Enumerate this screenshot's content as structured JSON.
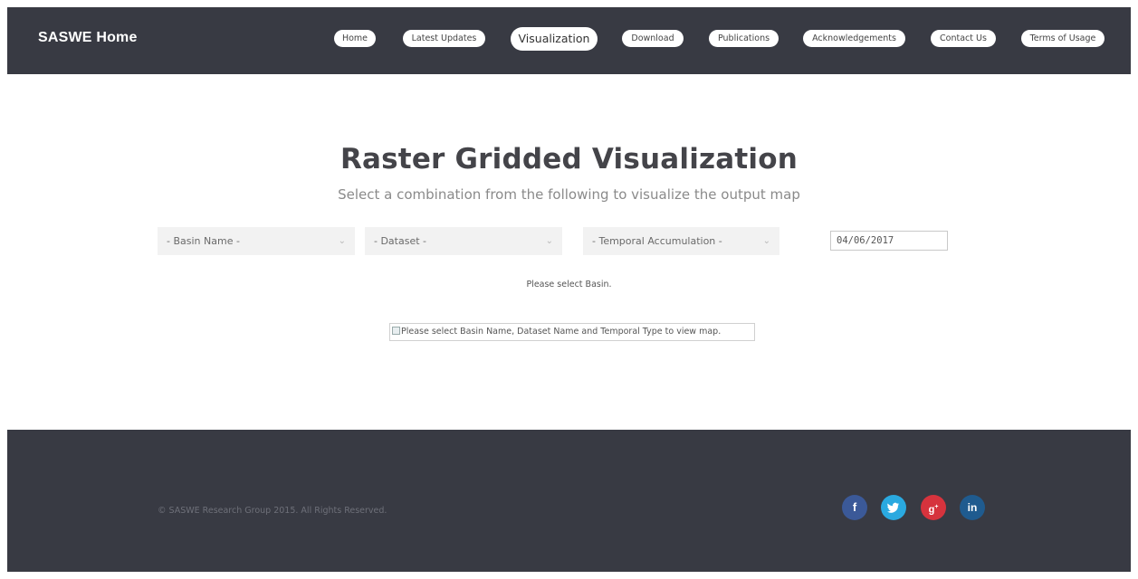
{
  "header": {
    "brand": "SASWE Home",
    "nav": [
      {
        "label": "Home"
      },
      {
        "label": "Latest Updates"
      },
      {
        "label": "Visualization",
        "active": true
      },
      {
        "label": "Download"
      },
      {
        "label": "Publications"
      },
      {
        "label": "Acknowledgements"
      },
      {
        "label": "Contact Us"
      },
      {
        "label": "Terms of Usage"
      }
    ]
  },
  "main": {
    "title": "Raster Gridded Visualization",
    "subtitle": "Select a combination from the following to visualize the output map",
    "selects": {
      "basin": "- Basin Name -",
      "dataset": "- Dataset -",
      "temporal": "- Temporal Accumulation -"
    },
    "date_value": "04/06/2017",
    "status": "Please select Basin.",
    "map_alt": "Please select Basin Name, Dataset Name and Temporal Type to view map."
  },
  "footer": {
    "copyright": "© SASWE Research Group 2015. All Rights Reserved.",
    "social": [
      {
        "icon": "facebook-icon",
        "glyph": "f",
        "color": "#3b5998"
      },
      {
        "icon": "twitter-icon",
        "glyph": "t",
        "color": "#2aa9e0"
      },
      {
        "icon": "google-plus-icon",
        "glyph": "g+",
        "color": "#d6333d"
      },
      {
        "icon": "linkedin-icon",
        "glyph": "in",
        "color": "#1f5b8f"
      }
    ]
  },
  "colors": {
    "header_bg": "#383a43",
    "footer_bg": "#383a43",
    "title": "#444449"
  }
}
